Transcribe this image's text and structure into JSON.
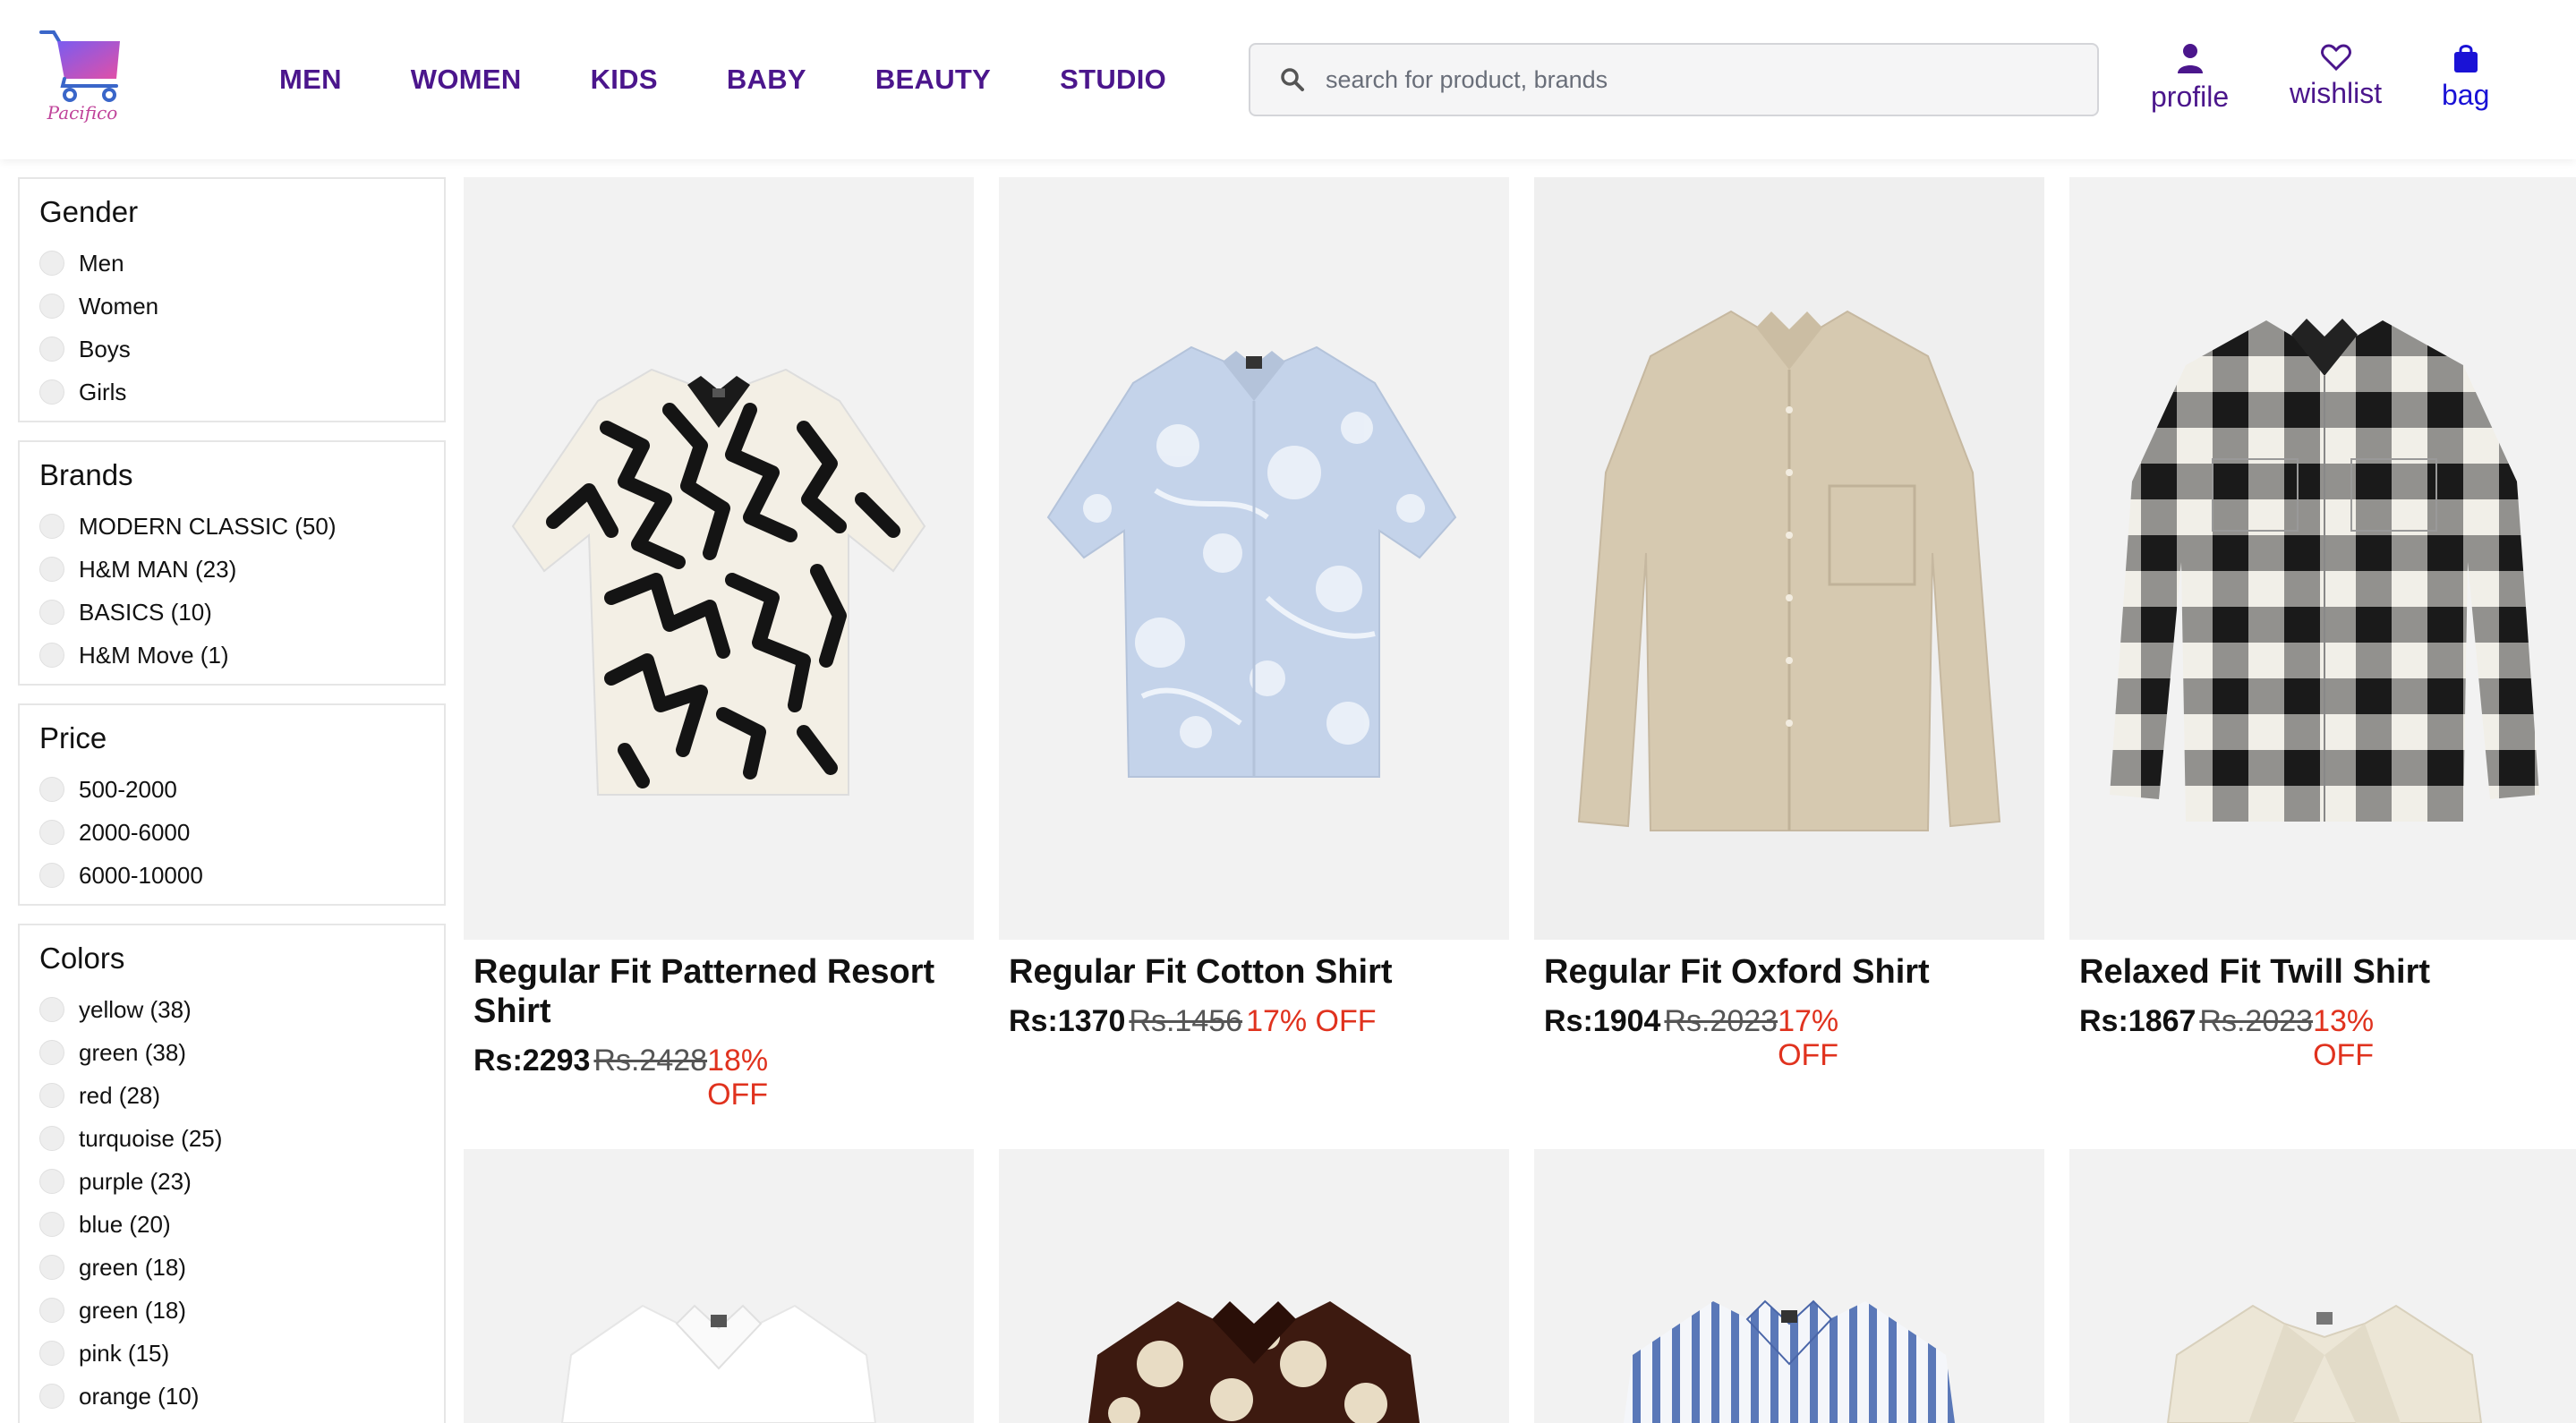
{
  "brand": {
    "logo_text": "Pacifico",
    "primary": "#4b168c",
    "accent": "#c0439a"
  },
  "nav": [
    "MEN",
    "WOMEN",
    "KIDS",
    "BABY",
    "BEAUTY",
    "STUDIO"
  ],
  "search": {
    "placeholder": "search for product, brands",
    "icon": "search-icon"
  },
  "actions": {
    "profile": "profile",
    "wishlist": "wishlist",
    "bag": "bag"
  },
  "filters": {
    "gender": {
      "title": "Gender",
      "options": [
        "Men",
        "Women",
        "Boys",
        "Girls"
      ]
    },
    "brands": {
      "title": "Brands",
      "options": [
        "MODERN CLASSIC (50)",
        "H&M MAN (23)",
        "BASICS (10)",
        "H&M Move (1)"
      ]
    },
    "price": {
      "title": "Price",
      "options": [
        "500-2000",
        "2000-6000",
        "6000-10000"
      ]
    },
    "colors": {
      "title": "Colors",
      "options": [
        "yellow (38)",
        "green (38)",
        "red (28)",
        "turquoise (25)",
        "purple (23)",
        "blue (20)",
        "green (18)",
        "green (18)",
        "pink (15)",
        "orange (10)"
      ]
    }
  },
  "products": [
    {
      "name": "Regular Fit Patterned Resort Shirt",
      "price": "Rs:2293",
      "mrp": "Rs.2428",
      "off": "18% OFF"
    },
    {
      "name": "Regular Fit Cotton Shirt",
      "price": "Rs:1370",
      "mrp": "Rs.1456",
      "off": "17% OFF"
    },
    {
      "name": "Regular Fit Oxford Shirt",
      "price": "Rs:1904",
      "mrp": "Rs.2023",
      "off": "17% OFF"
    },
    {
      "name": "Relaxed Fit Twill Shirt",
      "price": "Rs:1867",
      "mrp": "Rs.2023",
      "off": "13% OFF"
    }
  ],
  "colors": {
    "discount": "#e0321e",
    "bag_icon": "#1a12d6"
  }
}
